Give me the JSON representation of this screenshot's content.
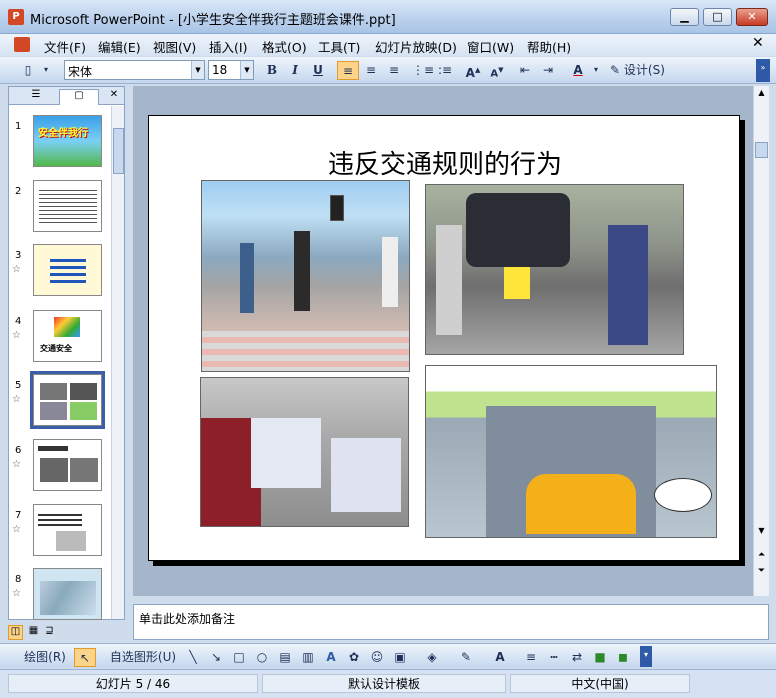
{
  "window": {
    "app_icon": "P",
    "title": "Microsoft PowerPoint - [小学生安全伴我行主题班会课件.ppt]",
    "minimize": "▁",
    "maximize": "□",
    "close": "✕"
  },
  "menu": [
    "文件(F)",
    "编辑(E)",
    "视图(V)",
    "插入(I)",
    "格式(O)",
    "工具(T)",
    "幻灯片放映(D)",
    "窗口(W)",
    "帮助(H)"
  ],
  "doc_close": "✕",
  "toolbar": {
    "font": "宋体",
    "size": "18",
    "bold": "B",
    "italic": "I",
    "underline": "U",
    "design": "设计(S)",
    "font_color": "A"
  },
  "panel": {
    "tab_outline": "☰",
    "tab_slides": "▢",
    "close": "✕",
    "thumbs": [
      {
        "num": "1",
        "title": "安全伴我行",
        "star": false
      },
      {
        "num": "2",
        "title": "",
        "star": false
      },
      {
        "num": "3",
        "title": "",
        "star": true
      },
      {
        "num": "4",
        "title": "交通安全",
        "star": true
      },
      {
        "num": "5",
        "title": "",
        "star": true
      },
      {
        "num": "6",
        "title": "",
        "star": true
      },
      {
        "num": "7",
        "title": "",
        "star": true
      },
      {
        "num": "8",
        "title": "",
        "star": true
      }
    ]
  },
  "slide": {
    "title": "违反交通规则的行为"
  },
  "notes": {
    "placeholder": "单击此处添加备注"
  },
  "drawbar": {
    "draw": "绘图(R)",
    "autoshape": "自选图形(U)"
  },
  "status": {
    "slide": "幻灯片 5 / 46",
    "template": "默认设计模板",
    "language": "中文(中国)"
  },
  "colors": {
    "accent": "#d24726",
    "selection": "#3b5ea8",
    "highlight": "#fbd489"
  }
}
